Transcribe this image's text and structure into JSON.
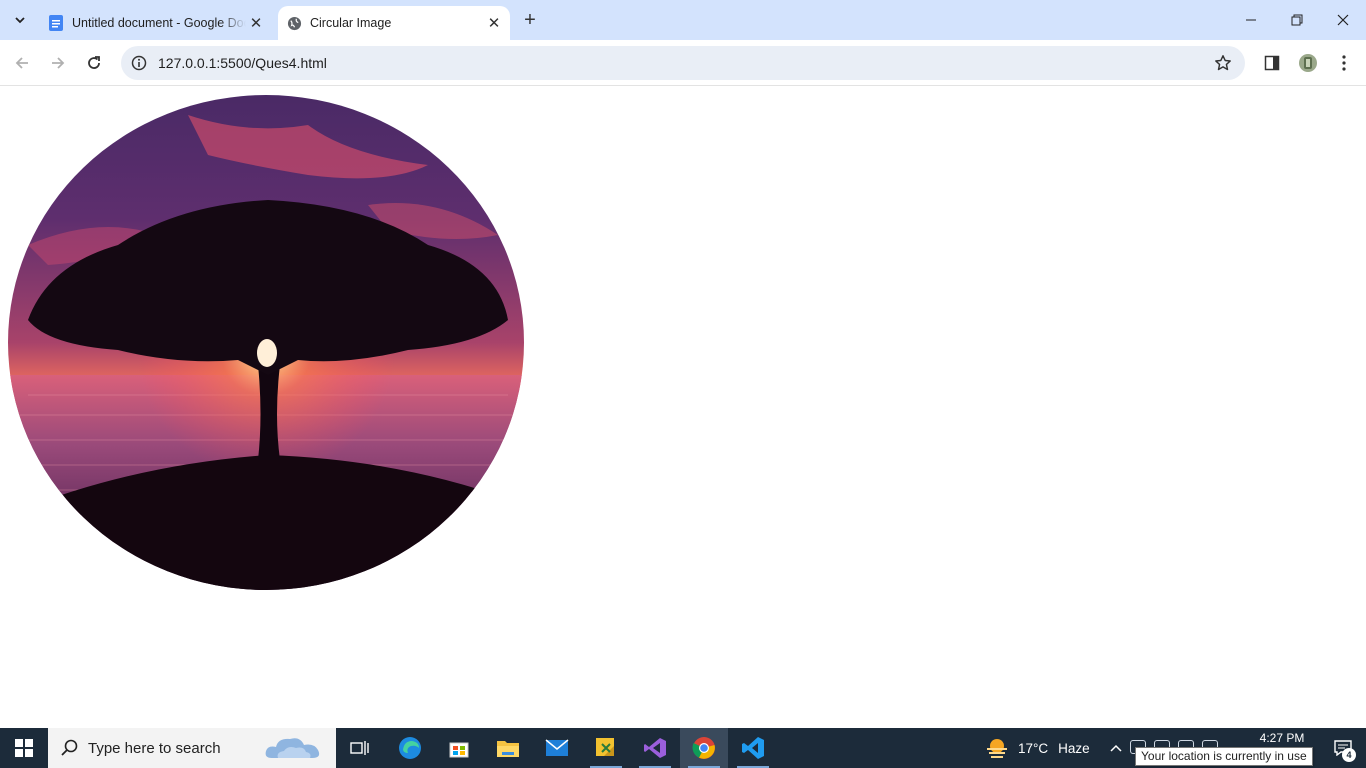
{
  "browser": {
    "tabs": [
      {
        "title": "Untitled document - Google Docs",
        "favicon": "docs-icon",
        "active": false
      },
      {
        "title": "Circular Image",
        "favicon": "globe-icon",
        "active": true
      }
    ],
    "url": "127.0.0.1:5500/Ques4.html"
  },
  "page": {
    "image_description_icon": "sunset-tree-image"
  },
  "taskbar": {
    "search_placeholder": "Type here to search",
    "weather": {
      "temp": "17°C",
      "condition": "Haze"
    },
    "clock": {
      "time": "4:27 PM"
    },
    "notifications_count": "4",
    "tooltip": "Your location is currently in use"
  },
  "colors": {
    "tabstrip": "#d3e3fd",
    "omnibox": "#e9eef6",
    "taskbar": "#1c2b3a"
  }
}
